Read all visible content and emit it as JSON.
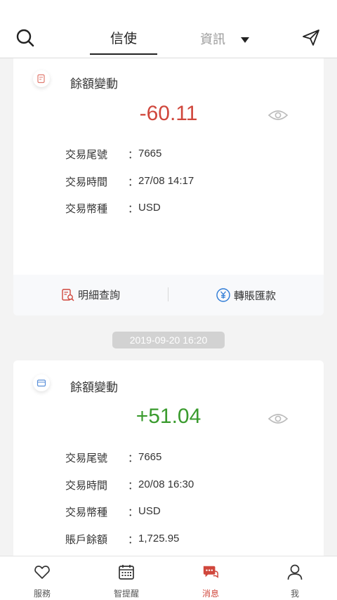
{
  "header": {
    "tab_active": "信使",
    "tab_inactive": "資訊"
  },
  "colors": {
    "negative": "#d0473c",
    "positive": "#3a9b2e",
    "active_nav": "#d0473c"
  },
  "cards": [
    {
      "title": "餘額變動",
      "amount": "-60.11",
      "rows": [
        {
          "label": "交易尾號",
          "value": "7665"
        },
        {
          "label": "交易時間",
          "value": "27/08 14:17"
        },
        {
          "label": "交易幣種",
          "value": "USD"
        }
      ],
      "actions": {
        "detail": "明細查詢",
        "transfer": "轉賬匯款"
      }
    },
    {
      "title": "餘額變動",
      "amount": "+51.04",
      "rows": [
        {
          "label": "交易尾號",
          "value": "7665"
        },
        {
          "label": "交易時間",
          "value": "20/08 16:30"
        },
        {
          "label": "交易幣種",
          "value": "USD"
        },
        {
          "label": "賬戶餘額",
          "value": "1,725.95"
        }
      ]
    }
  ],
  "date_chip": "2019-09-20 16:20",
  "colon": "：",
  "bottom_nav": [
    {
      "label": "服務",
      "icon": "heart-icon"
    },
    {
      "label": "智提醒",
      "icon": "calendar-icon"
    },
    {
      "label": "消息",
      "icon": "message-icon",
      "active": true
    },
    {
      "label": "我",
      "icon": "person-icon"
    }
  ]
}
